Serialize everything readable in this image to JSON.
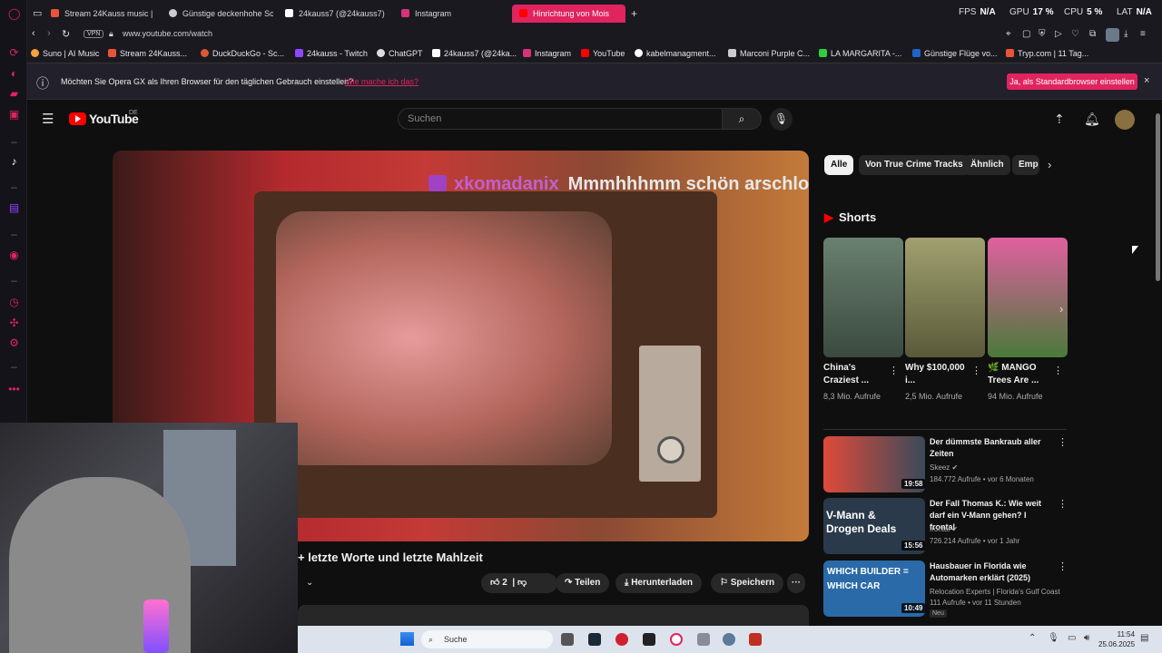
{
  "browser": {
    "tabs": [
      {
        "label": "Stream 24Kauss music |",
        "color": "#e8543a"
      },
      {
        "label": "Günstige deckenhohe Sc",
        "color": "#cccccc"
      },
      {
        "label": "24kauss7 (@24kauss7)",
        "color": "#ffffff"
      },
      {
        "label": "Instagram",
        "color": "#d6337a"
      },
      {
        "label": "Hinrichtung von Mois",
        "color": "#ff0000"
      }
    ],
    "new_tab": "+",
    "perf": {
      "fps_label": "FPS",
      "fps": "N/A",
      "gpu_label": "GPU",
      "gpu": "17 %",
      "cpu_label": "CPU",
      "cpu": "5 %",
      "lat_label": "LAT",
      "lat": "N/A"
    },
    "vpn_label": "VPN",
    "url": "www.youtube.com/watch",
    "bookmarks": [
      {
        "label": "Suno | AI Music",
        "color": "#f2a33a"
      },
      {
        "label": "Stream 24Kauss...",
        "color": "#e8543a"
      },
      {
        "label": "DuckDuckGo - Sc...",
        "color": "#de5833"
      },
      {
        "label": "24kauss - Twitch",
        "color": "#9146ff"
      },
      {
        "label": "ChatGPT",
        "color": "#dddddd"
      },
      {
        "label": "24kauss7 (@24ka...",
        "color": "#ffffff"
      },
      {
        "label": "Instagram",
        "color": "#d6337a"
      },
      {
        "label": "YouTube",
        "color": "#ff0000"
      },
      {
        "label": "kabelmanagment...",
        "color": "#ffffff"
      },
      {
        "label": "Marconi Purple C...",
        "color": "#cccccc"
      },
      {
        "label": "LA MARGARITA -...",
        "color": "#2ecc40"
      },
      {
        "label": "Günstige Flüge vo...",
        "color": "#1e64c8"
      },
      {
        "label": "Tryp.com | 11 Tag...",
        "color": "#e8543a"
      }
    ]
  },
  "notification": {
    "message": "Möchten Sie Opera GX als Ihren Browser für den täglichen Gebrauch einstellen?",
    "link": "Wie mache ich das?",
    "button": "Ja, als Standardbrowser einstellen",
    "close": "×"
  },
  "youtube": {
    "logo": "YouTube",
    "region": "DE",
    "search_placeholder": "Suchen",
    "video": {
      "chat_user": "xkomadanix",
      "chat_text": "Mmmhhhmm schön arschloch ins gesic",
      "title": "+ letzte Worte und letzte Mahlzeit",
      "likes": "2",
      "share": "Teilen",
      "download": "Herunterladen",
      "save": "Speichern",
      "more": "···"
    },
    "chips": [
      "Alle",
      "Von True Crime Tracks",
      "Ähnlich",
      "Emp"
    ],
    "shorts_heading": "Shorts",
    "shorts": [
      {
        "title": "China's Craziest ...",
        "views": "8,3 Mio. Aufrufe",
        "color": "#4a5a4a"
      },
      {
        "title": "Why $100,000 i...",
        "views": "2,5 Mio. Aufrufe",
        "color": "#8a8a5a"
      },
      {
        "title": "🌿 MANGO Trees Are ...",
        "views": "94 Mio. Aufrufe",
        "color": "#c85a9a"
      }
    ],
    "videos": [
      {
        "title": "Der dümmste Bankraub aller Zeiten",
        "channel": "Skeez ✔",
        "meta": "184.772 Aufrufe • vor 6 Monaten",
        "duration": "19:58",
        "color": "#c84a3a"
      },
      {
        "title": "Der Fall Thomas K.: Wie weit darf ein V-Mann gehen? I frontal",
        "channel": "frontal ✔",
        "meta": "726.214 Aufrufe • vor 1 Jahr",
        "duration": "15:56",
        "color": "#2a3a4a",
        "thumb_text": "V-Mann & Drogen Deals"
      },
      {
        "title": "Hausbauer in Florida wie Automarken erklärt (2025)",
        "channel": "Relocation Experts | Florida's Gulf Coast",
        "meta": "111 Aufrufe • vor 11 Stunden",
        "duration": "10:49",
        "color": "#2a6aa8",
        "thumb_text": "WHICH BUILDER = WHICH CAR",
        "badge": "Neu"
      }
    ]
  },
  "taskbar": {
    "search": "Suche",
    "time": "11:54",
    "date": "25.06.2025"
  }
}
